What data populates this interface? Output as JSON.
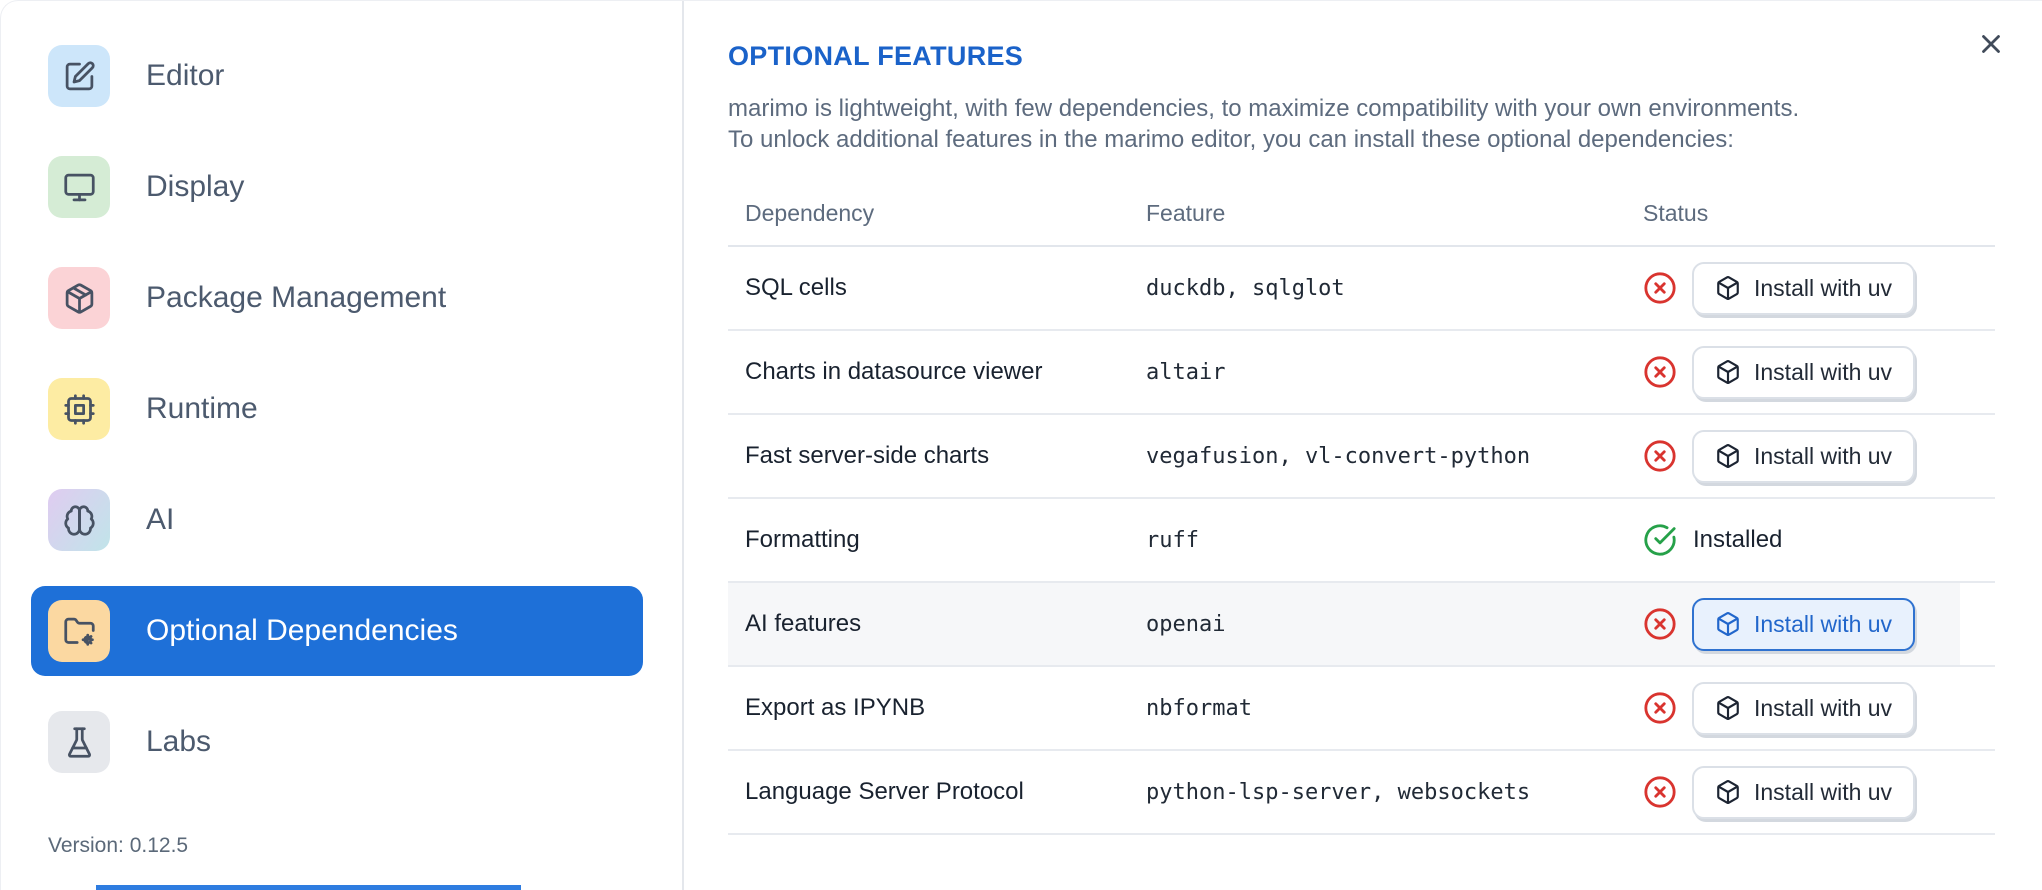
{
  "sidebar": {
    "items": [
      {
        "label": "Editor",
        "icon": "square-pen-icon",
        "icon_bg": "#cde6fa"
      },
      {
        "label": "Display",
        "icon": "monitor-icon",
        "icon_bg": "#d5ecd5"
      },
      {
        "label": "Package Management",
        "icon": "package-icon",
        "icon_bg": "#fbd3d6"
      },
      {
        "label": "Runtime",
        "icon": "cpu-icon",
        "icon_bg": "#fdeca3"
      },
      {
        "label": "AI",
        "icon": "brain-icon",
        "icon_bg": "gradient-purple-teal"
      },
      {
        "label": "Optional Dependencies",
        "icon": "folder-cog-icon",
        "icon_bg": "#fbd8a1",
        "selected": true
      },
      {
        "label": "Labs",
        "icon": "flask-icon",
        "icon_bg": "#e6e8ec"
      }
    ],
    "version": "Version: 0.12.5"
  },
  "dialog": {
    "close_icon": "x-icon"
  },
  "main": {
    "title": "OPTIONAL FEATURES",
    "description_line1": "marimo is lightweight, with few dependencies, to maximize compatibility with your own environments.",
    "description_line2": "To unlock additional features in the marimo editor, you can install these optional dependencies:",
    "table": {
      "headers": [
        "Dependency",
        "Feature",
        "Status"
      ],
      "install_button_label": "Install with uv",
      "installed_label": "Installed",
      "rows": [
        {
          "dependency": "SQL cells",
          "feature": "duckdb, sqlglot",
          "installed": false
        },
        {
          "dependency": "Charts in datasource viewer",
          "feature": "altair",
          "installed": false
        },
        {
          "dependency": "Fast server-side charts",
          "feature": "vegafusion, vl-convert-python",
          "installed": false
        },
        {
          "dependency": "Formatting",
          "feature": "ruff",
          "installed": true
        },
        {
          "dependency": "AI features",
          "feature": "openai",
          "installed": false,
          "highlighted": true
        },
        {
          "dependency": "Export as IPYNB",
          "feature": "nbformat",
          "installed": false
        },
        {
          "dependency": "Language Server Protocol",
          "feature": "python-lsp-server, websockets",
          "installed": false
        }
      ]
    }
  },
  "colors": {
    "accent_blue": "#1e70d8",
    "title_blue": "#1a62c9",
    "error_red": "#d9342f",
    "success_green": "#26a149",
    "focused_button_bg": "#e8f1fd",
    "focused_button_border": "#2f72d0",
    "row_highlight": "#f6f7f9"
  }
}
